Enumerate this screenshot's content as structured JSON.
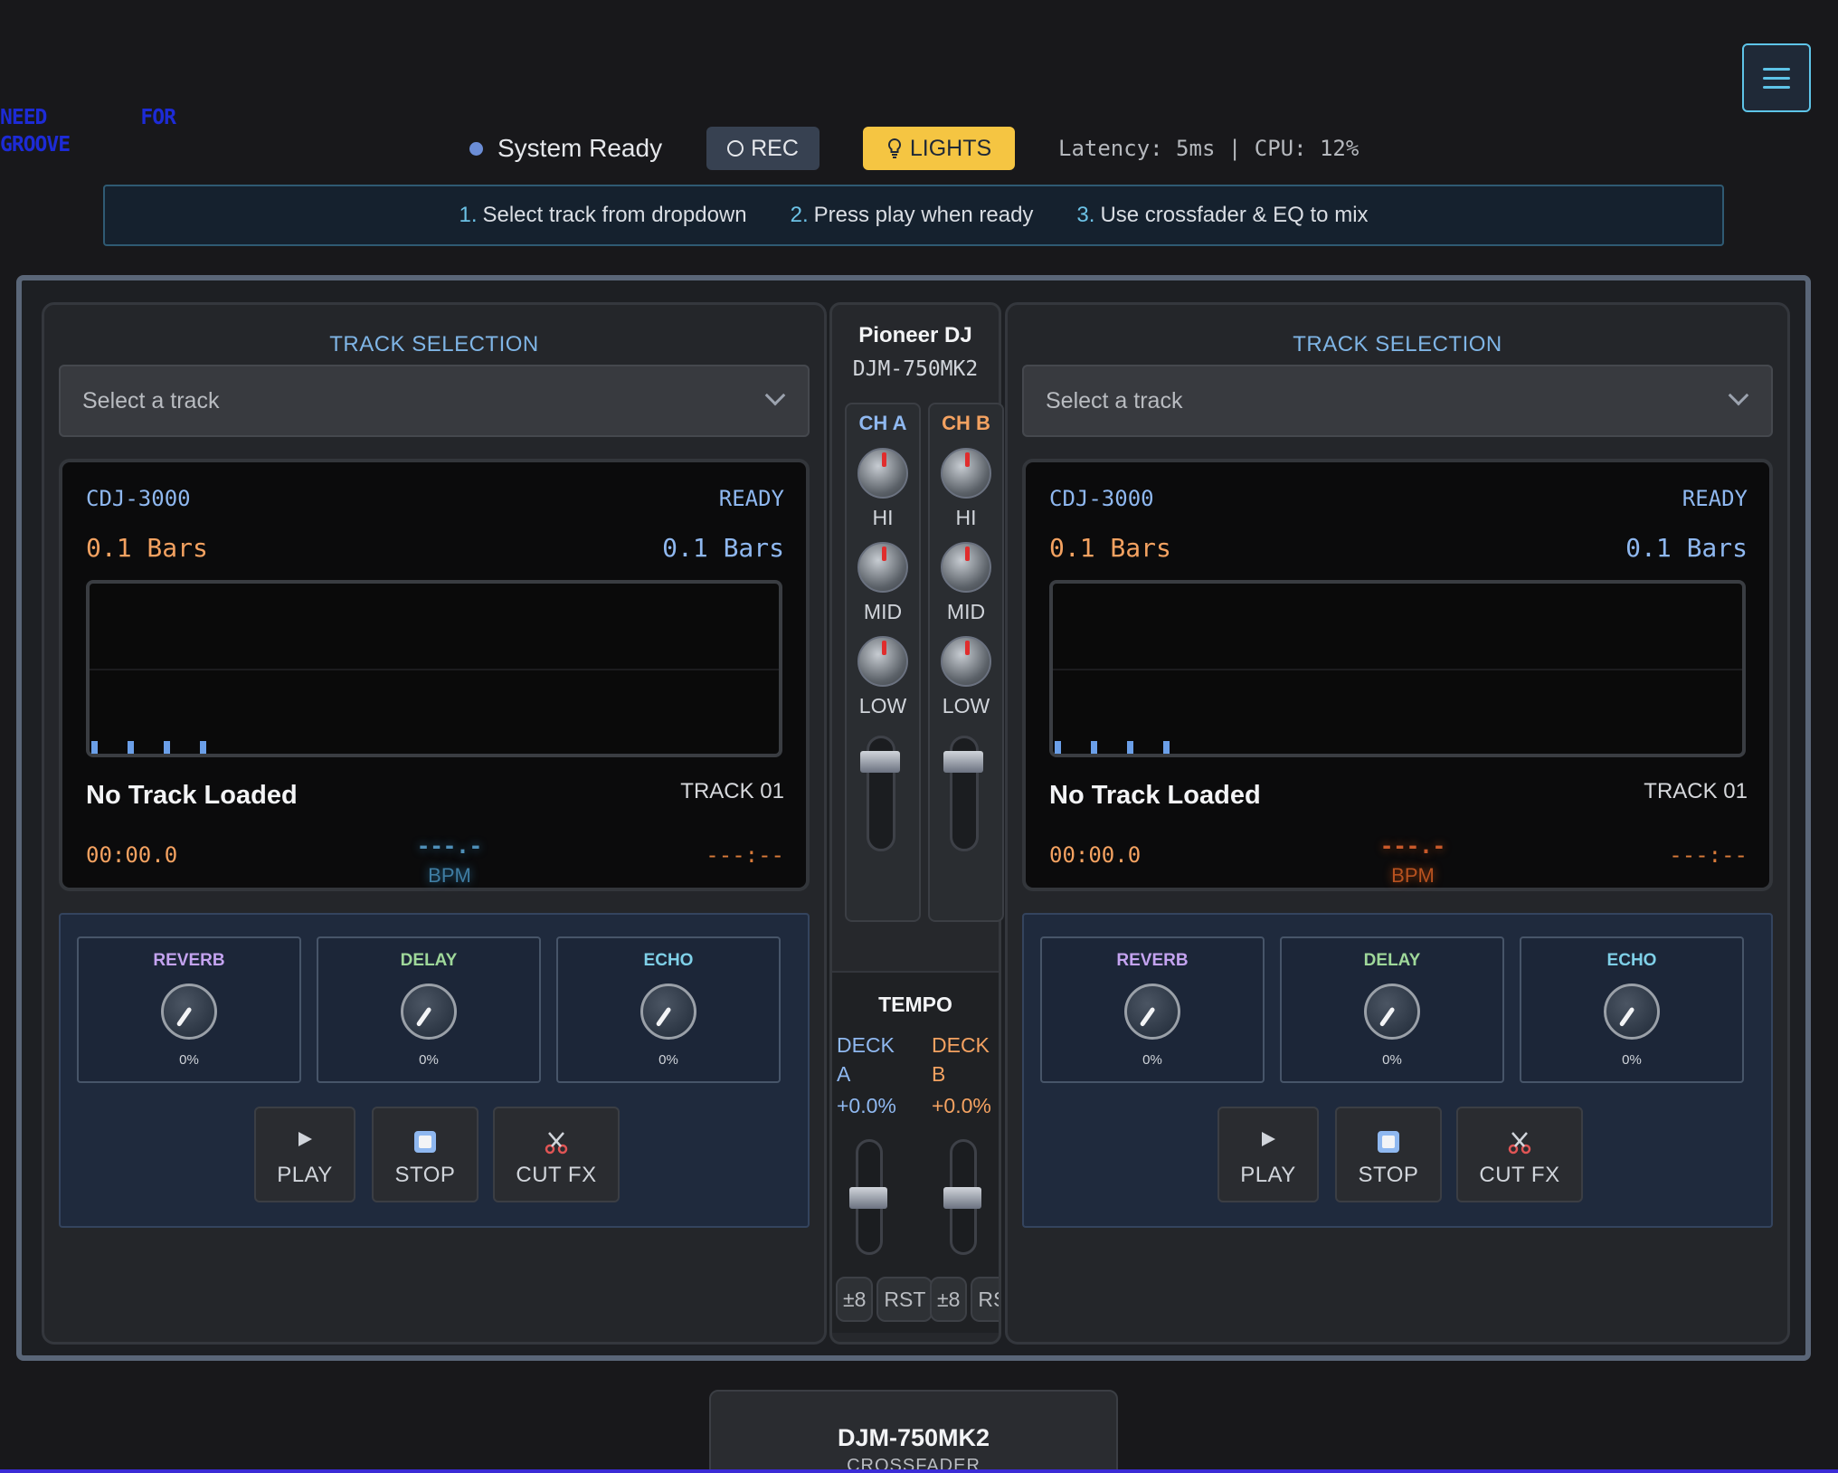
{
  "logo": {
    "line1": [
      "NEED",
      "FOR"
    ],
    "line2": "GROOVE"
  },
  "menu_icon": "hamburger-icon",
  "status": {
    "label": "System Ready",
    "rec_label": "REC",
    "lights_label": "LIGHTS",
    "metrics": "Latency: 5ms | CPU: 12%"
  },
  "instructions": [
    {
      "num": "1.",
      "text": "Select track from dropdown"
    },
    {
      "num": "2.",
      "text": "Press play when ready"
    },
    {
      "num": "3.",
      "text": "Use crossfader & EQ to mix"
    }
  ],
  "decks": [
    {
      "section_title": "TRACK SELECTION",
      "select_placeholder": "Select a track",
      "model": "CDJ-3000",
      "state": "READY",
      "bars_left": "0.1 Bars",
      "bars_right": "0.1 Bars",
      "track_name": "No Track Loaded",
      "track_number": "TRACK 01",
      "time": "00:00.0",
      "bpm_value": "---.-",
      "bpm_unit": "BPM",
      "remaining": "---:--",
      "fx": [
        {
          "name": "REVERB",
          "value": "0%",
          "color": "#c4a3f0"
        },
        {
          "name": "DELAY",
          "value": "0%",
          "color": "#9fd89a"
        },
        {
          "name": "ECHO",
          "value": "0%",
          "color": "#7fd0e8"
        }
      ],
      "buttons": {
        "play": "PLAY",
        "stop": "STOP",
        "cut": "CUT FX"
      }
    },
    {
      "section_title": "TRACK SELECTION",
      "select_placeholder": "Select a track",
      "model": "CDJ-3000",
      "state": "READY",
      "bars_left": "0.1 Bars",
      "bars_right": "0.1 Bars",
      "track_name": "No Track Loaded",
      "track_number": "TRACK 01",
      "time": "00:00.0",
      "bpm_value": "---.-",
      "bpm_unit": "BPM",
      "remaining": "---:--",
      "fx": [
        {
          "name": "REVERB",
          "value": "0%",
          "color": "#c4a3f0"
        },
        {
          "name": "DELAY",
          "value": "0%",
          "color": "#9fd89a"
        },
        {
          "name": "ECHO",
          "value": "0%",
          "color": "#7fd0e8"
        }
      ],
      "buttons": {
        "play": "PLAY",
        "stop": "STOP",
        "cut": "CUT FX"
      }
    }
  ],
  "mixer": {
    "brand": "Pioneer DJ",
    "model": "DJM-750MK2",
    "channels": [
      {
        "label": "CH A",
        "color": "#8fb8f0",
        "eq": [
          "HI",
          "MID",
          "LOW"
        ]
      },
      {
        "label": "CH B",
        "color": "#f4a261",
        "eq": [
          "HI",
          "MID",
          "LOW"
        ]
      }
    ],
    "tempo": {
      "title": "TEMPO",
      "deck_a_line1": "DECK",
      "deck_a_line2": "A",
      "deck_b_line1": "DECK",
      "deck_b_line2": "B",
      "deck_a_value": "+0.0%",
      "deck_b_value": "+0.0%",
      "range_a": "±8",
      "reset_a": "RST",
      "range_b": "±8",
      "reset_b": "RS"
    }
  },
  "crossfader": {
    "model": "DJM-750MK2",
    "label": "CROSSFADER"
  }
}
